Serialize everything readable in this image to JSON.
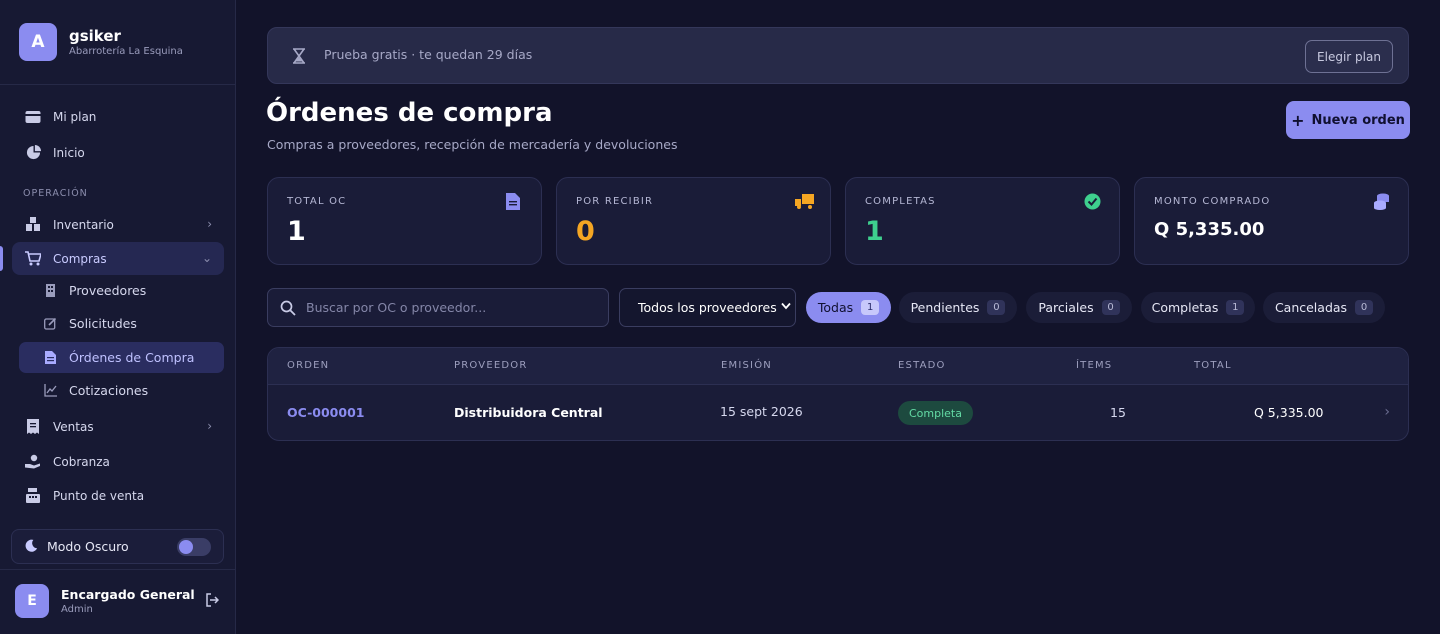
{
  "sidebar": {
    "brand_initial": "A",
    "brand_name": "gsiker",
    "brand_sub": "Abarrotería La Esquina",
    "items_top": [
      {
        "label": "Mi plan",
        "icon": "card-icon"
      },
      {
        "label": "Inicio",
        "icon": "pie-chart-icon"
      }
    ],
    "section_label": "OPERACIÓN",
    "inventario": "Inventario",
    "compras": "Compras",
    "compras_sub": [
      {
        "label": "Proveedores",
        "icon": "building-icon"
      },
      {
        "label": "Solicitudes",
        "icon": "edit-icon"
      },
      {
        "label": "Órdenes de Compra",
        "icon": "document-icon"
      },
      {
        "label": "Cotizaciones",
        "icon": "chart-icon"
      }
    ],
    "ventas": "Ventas",
    "cobranza": "Cobranza",
    "pos": "Punto de venta",
    "dark_mode_label": "Modo Oscuro",
    "dark_mode_on": true,
    "user_initial": "E",
    "user_name": "Encargado General",
    "user_role": "Admin"
  },
  "trial": {
    "text": "Prueba gratis · te quedan 29 días",
    "button": "Elegir plan"
  },
  "header": {
    "title": "Órdenes de compra",
    "subtitle": "Compras a proveedores, recepción de mercadería y devoluciones",
    "new_button": "Nueva orden"
  },
  "stats": [
    {
      "label": "TOTAL OC",
      "value": "1",
      "color": "#ffffff",
      "icon": "document-icon",
      "icon_color": "#8b8cf0"
    },
    {
      "label": "POR RECIBIR",
      "value": "0",
      "color": "#f5a623",
      "icon": "truck-icon",
      "icon_color": "#f5a623"
    },
    {
      "label": "COMPLETAS",
      "value": "1",
      "color": "#3ecf8e",
      "icon": "check-circle-icon",
      "icon_color": "#3ecf8e"
    },
    {
      "label": "MONTO COMPRADO",
      "value": "Q 5,335.00",
      "color": "#ffffff",
      "icon": "coins-icon",
      "icon_color": "#8b8cf0"
    }
  ],
  "filters": {
    "search_placeholder": "Buscar por OC o proveedor...",
    "provider_select": "Todos los proveedores",
    "pills": [
      {
        "label": "Todas",
        "count": "1",
        "active": true
      },
      {
        "label": "Pendientes",
        "count": "0"
      },
      {
        "label": "Parciales",
        "count": "0"
      },
      {
        "label": "Completas",
        "count": "1"
      },
      {
        "label": "Canceladas",
        "count": "0"
      }
    ]
  },
  "table": {
    "columns": [
      "ORDEN",
      "PROVEEDOR",
      "EMISIÓN",
      "ESTADO",
      "ÍTEMS",
      "TOTAL"
    ],
    "rows": [
      {
        "orden": "OC-000001",
        "proveedor": "Distribuidora Central",
        "emision": "15 sept 2026",
        "estado": "Completa",
        "items": "15",
        "total": "Q 5,335.00"
      }
    ]
  }
}
